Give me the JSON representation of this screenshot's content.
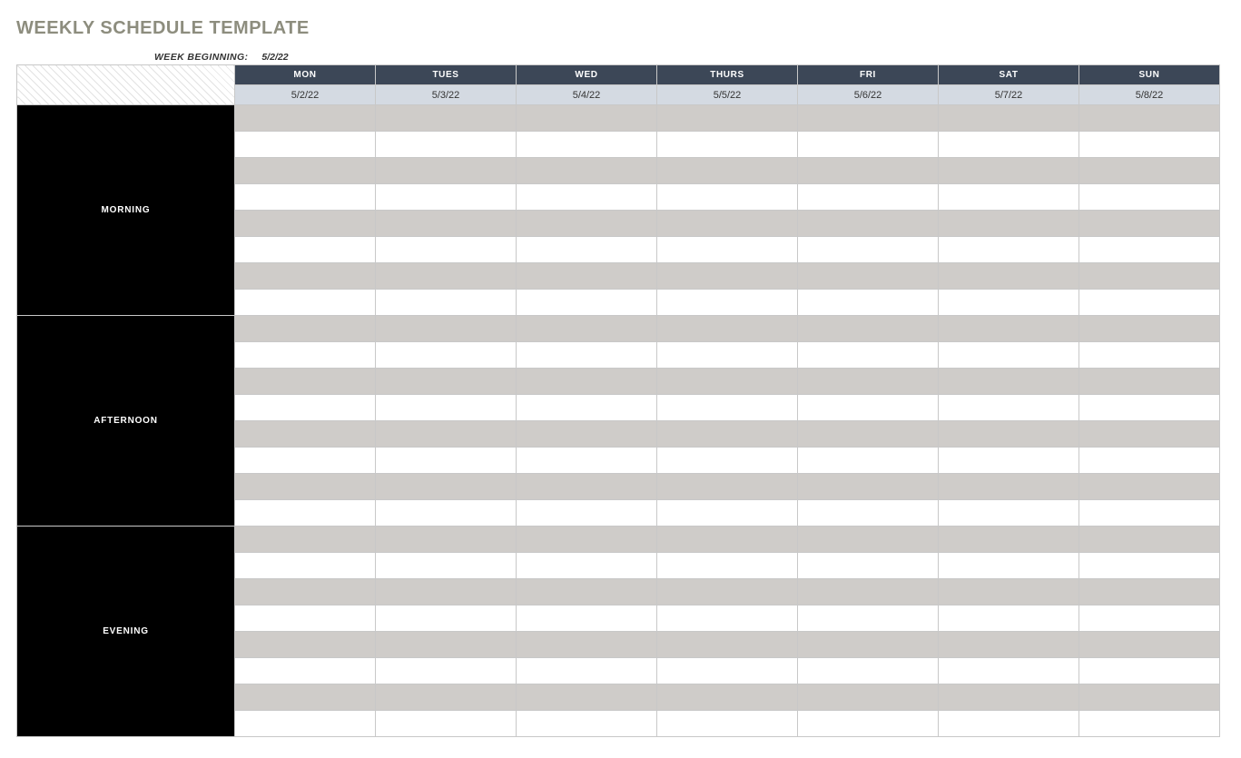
{
  "title": "WEEKLY SCHEDULE TEMPLATE",
  "week_beginning_label": "WEEK BEGINNING:",
  "week_beginning_date": "5/2/22",
  "days": [
    {
      "name": "MON",
      "date": "5/2/22"
    },
    {
      "name": "TUES",
      "date": "5/3/22"
    },
    {
      "name": "WED",
      "date": "5/4/22"
    },
    {
      "name": "THURS",
      "date": "5/5/22"
    },
    {
      "name": "FRI",
      "date": "5/6/22"
    },
    {
      "name": "SAT",
      "date": "5/7/22"
    },
    {
      "name": "SUN",
      "date": "5/8/22"
    }
  ],
  "periods": [
    {
      "label": "MORNING",
      "rows": 8
    },
    {
      "label": "AFTERNOON",
      "rows": 8
    },
    {
      "label": "EVENING",
      "rows": 8
    }
  ],
  "cells": {}
}
